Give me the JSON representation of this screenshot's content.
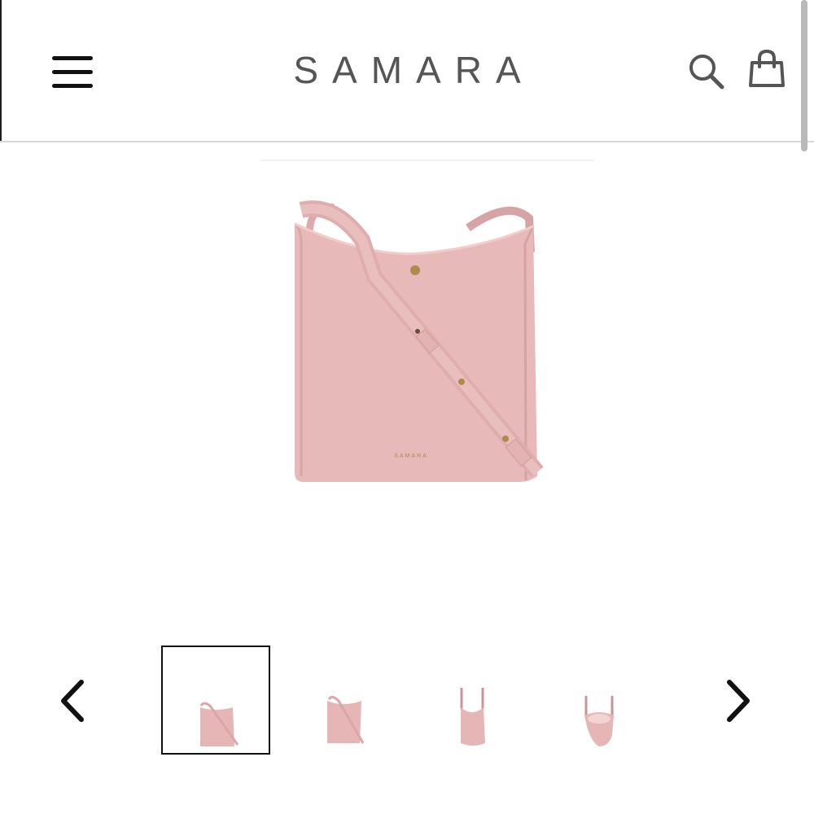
{
  "header": {
    "brand": "SAMARA",
    "menu_icon": "hamburger-menu-icon",
    "search_icon": "search-icon",
    "cart_icon": "shopping-bag-icon"
  },
  "product": {
    "main_image": "pink-leather-crossbody-bucket-bag",
    "bag_logo_text": "SAMARA",
    "color": "#e7b9b8"
  },
  "gallery": {
    "prev_icon": "chevron-left-icon",
    "next_icon": "chevron-right-icon",
    "selected_index": 0,
    "thumbnails": [
      {
        "view": "front-with-strap"
      },
      {
        "view": "front-angle"
      },
      {
        "view": "side"
      },
      {
        "view": "top-open"
      }
    ]
  }
}
